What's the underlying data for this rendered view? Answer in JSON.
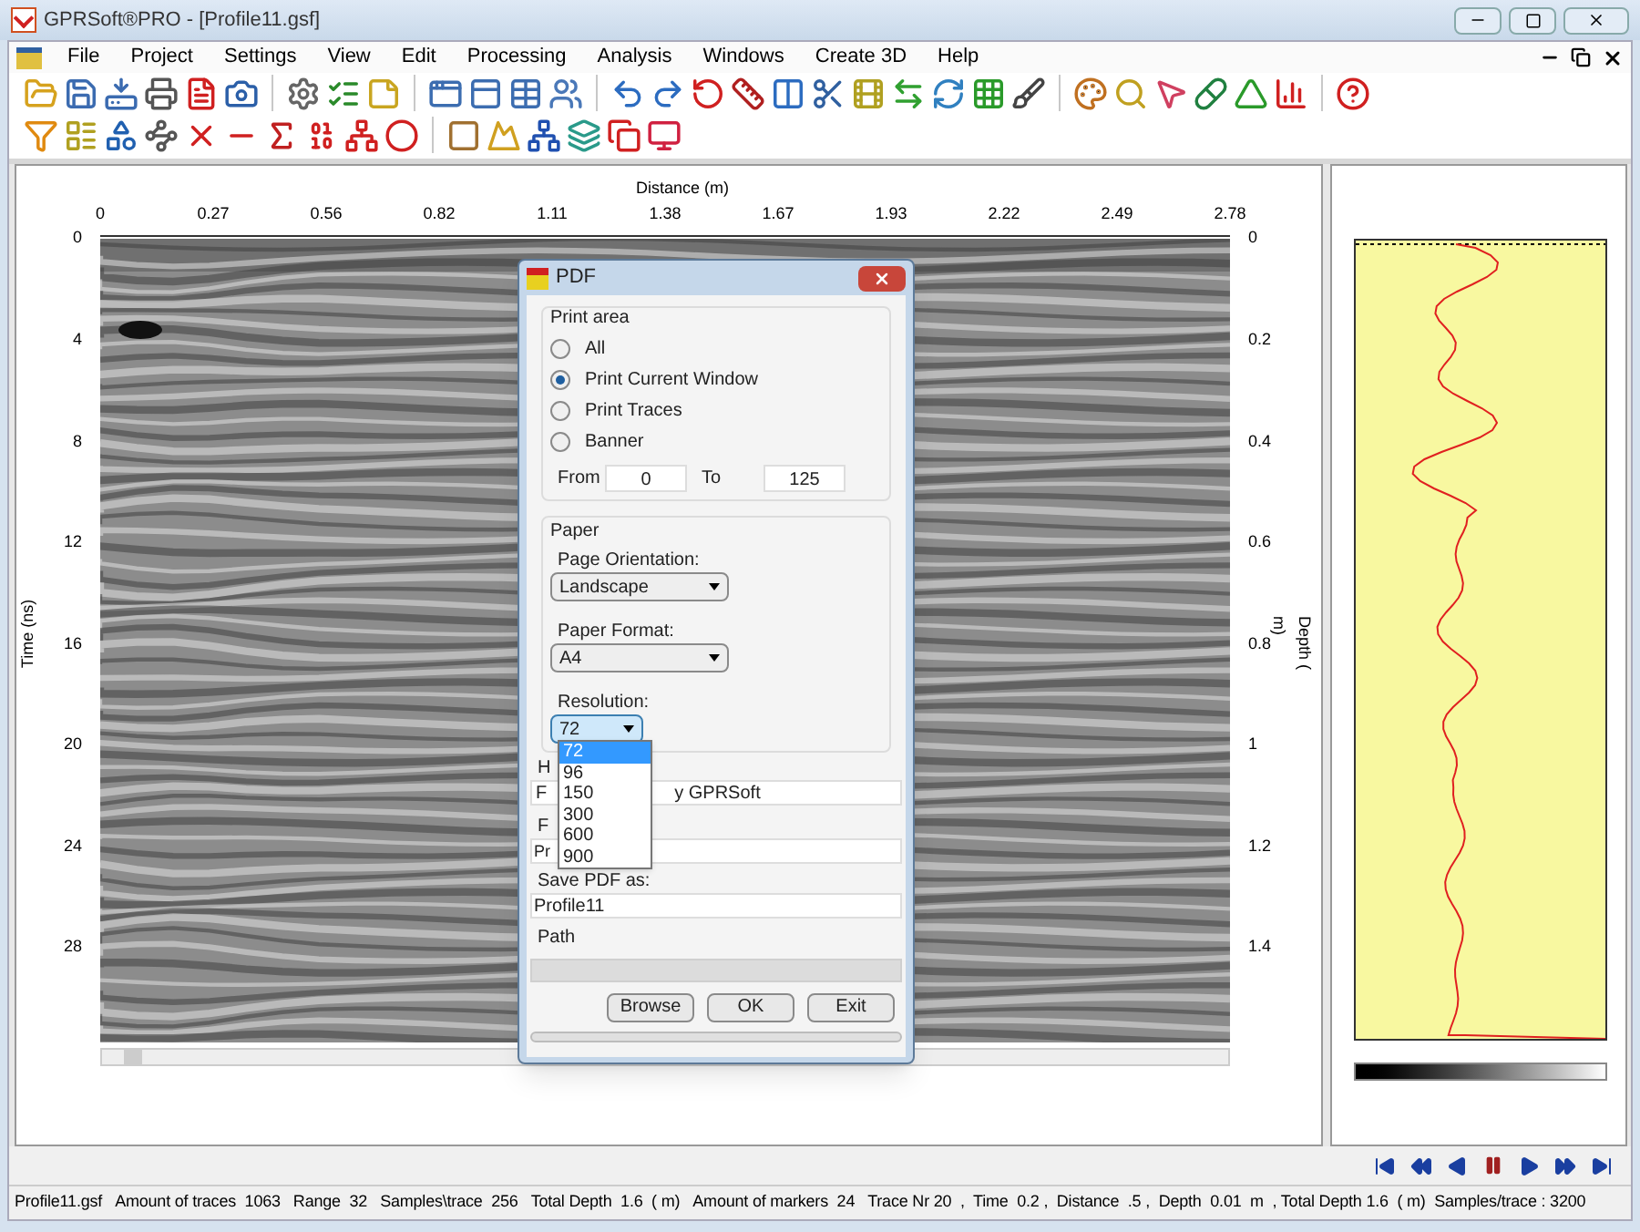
{
  "window": {
    "title": "GPRSoft®PRO - [Profile11.gsf]"
  },
  "menu": [
    "File",
    "Project",
    "Settings",
    "View",
    "Edit",
    "Processing",
    "Analysis",
    "Windows",
    "Create 3D",
    "Help"
  ],
  "profile": {
    "x_axis_title": "Distance (m)",
    "x_ticks": [
      "0",
      "0.27",
      "0.56",
      "0.82",
      "1.11",
      "1.38",
      "1.67",
      "1.93",
      "2.22",
      "2.49",
      "2.78"
    ],
    "y_axis_title": "Time (ns)",
    "y_ticks": [
      "0",
      "4",
      "8",
      "12",
      "16",
      "20",
      "24",
      "28"
    ],
    "depth_axis_title": "Depth ( m)",
    "depth_ticks": [
      "0",
      "0.2",
      "0.4",
      "0.6",
      "0.8",
      "1",
      "1.2",
      "1.4"
    ]
  },
  "dialog": {
    "title": "PDF",
    "print_area": {
      "title": "Print area",
      "options": [
        {
          "label": "All",
          "selected": false
        },
        {
          "label": "Print Current Window",
          "selected": true
        },
        {
          "label": "Print Traces",
          "selected": false
        },
        {
          "label": "Banner",
          "selected": false
        }
      ],
      "from_label": "From",
      "from_value": "0",
      "to_label": "To",
      "to_value": "125"
    },
    "paper": {
      "title": "Paper",
      "orientation_label": "Page Orientation:",
      "orientation_value": "Landscape",
      "format_label": "Paper Format:",
      "format_value": "A4",
      "resolution_label": "Resolution:",
      "resolution_value": "72",
      "resolution_options": [
        {
          "label": "72",
          "selected": true
        },
        {
          "label": "96",
          "selected": false
        },
        {
          "label": "150",
          "selected": false
        },
        {
          "label": "300",
          "selected": false
        },
        {
          "label": "600",
          "selected": false
        },
        {
          "label": "900",
          "selected": false
        }
      ]
    },
    "header_label": "H",
    "header_value_start": "F",
    "header_value_end": "y GPRSoft",
    "footer_label": "F",
    "footer_value": "Pr",
    "save_label": "Save PDF as:",
    "save_value": "Profile11",
    "path_label": "Path",
    "buttons": [
      "Browse",
      "OK",
      "Exit"
    ]
  },
  "status_bar": [
    "Profile11.gsf",
    "Amount of traces  1063",
    "Range  32",
    "Samples\\trace  256",
    "Total Depth  1.6  ( m)",
    "Amount of markers  24",
    "Trace Nr 20  ,  Time  0.2 ,  Distance  .5 ,  Depth  0.01  m  , Total Depth 1.6  ( m)  Samples/trace : 3200"
  ]
}
